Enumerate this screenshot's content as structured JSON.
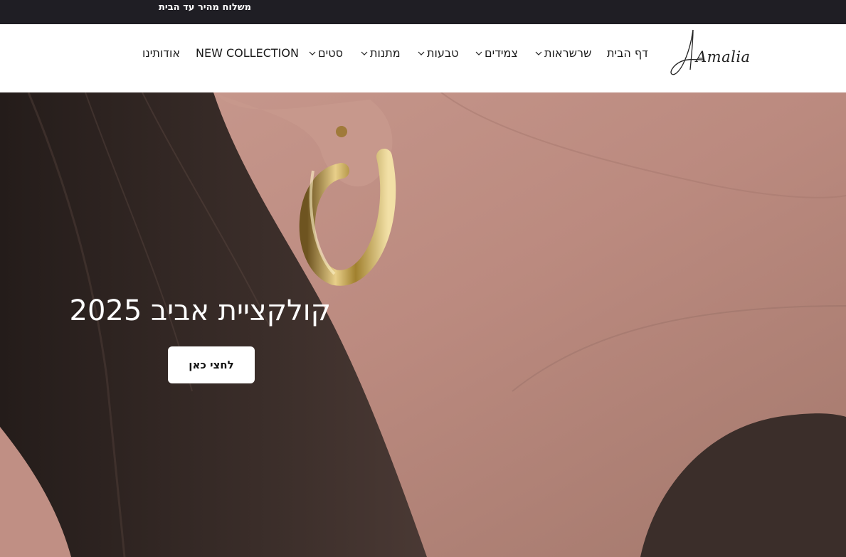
{
  "announcement": {
    "text": "משלוח מהיר עד הבית"
  },
  "header": {
    "logo_text": "Amalia",
    "nav": [
      {
        "label": "דף הבית",
        "has_dropdown": false
      },
      {
        "label": "שרשראות",
        "has_dropdown": true
      },
      {
        "label": "צמידים",
        "has_dropdown": true
      },
      {
        "label": "טבעות",
        "has_dropdown": true
      },
      {
        "label": "מתנות",
        "has_dropdown": true
      },
      {
        "label": "סטים",
        "has_dropdown": true
      },
      {
        "label": "NEW COLLECTION",
        "has_dropdown": false
      },
      {
        "label": "אודותינו",
        "has_dropdown": false
      }
    ]
  },
  "hero": {
    "title": "קולקציית אביב 2025",
    "button_label": "לחצי כאן"
  },
  "colors": {
    "announcement_bg": "#1f1e24",
    "header_bg": "#ffffff",
    "hero_text": "#ffffff",
    "button_bg": "#ffffff"
  }
}
